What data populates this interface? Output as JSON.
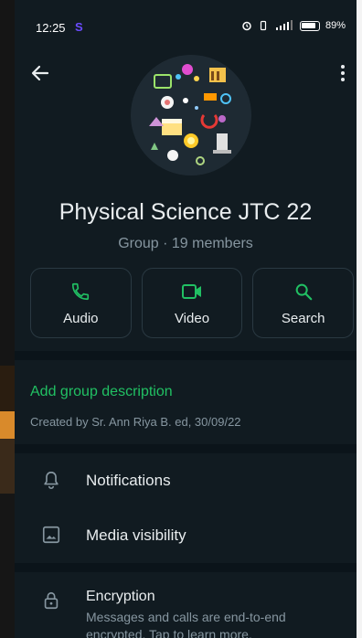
{
  "status_bar": {
    "time": "12:25",
    "app_badge": "S",
    "battery": "89%"
  },
  "header": {
    "group_name": "Physical Science JTC 22",
    "group_meta": "Group · 19 members"
  },
  "actions": [
    {
      "label": "Audio",
      "icon": "phone-icon"
    },
    {
      "label": "Video",
      "icon": "video-icon"
    },
    {
      "label": "Search",
      "icon": "search-icon"
    }
  ],
  "description": {
    "add_label": "Add group description",
    "created_by": "Created by Sr. Ann Riya B. ed, 30/09/22"
  },
  "settings": [
    {
      "label": "Notifications",
      "icon": "bell-icon"
    },
    {
      "label": "Media visibility",
      "icon": "image-icon"
    }
  ],
  "encryption": {
    "title": "Encryption",
    "subtitle": "Messages and calls are end-to-end encrypted. Tap to learn more."
  },
  "colors": {
    "accent": "#21c063",
    "background": "#111b21",
    "text_primary": "#e9edef",
    "text_secondary": "#8696a0"
  }
}
